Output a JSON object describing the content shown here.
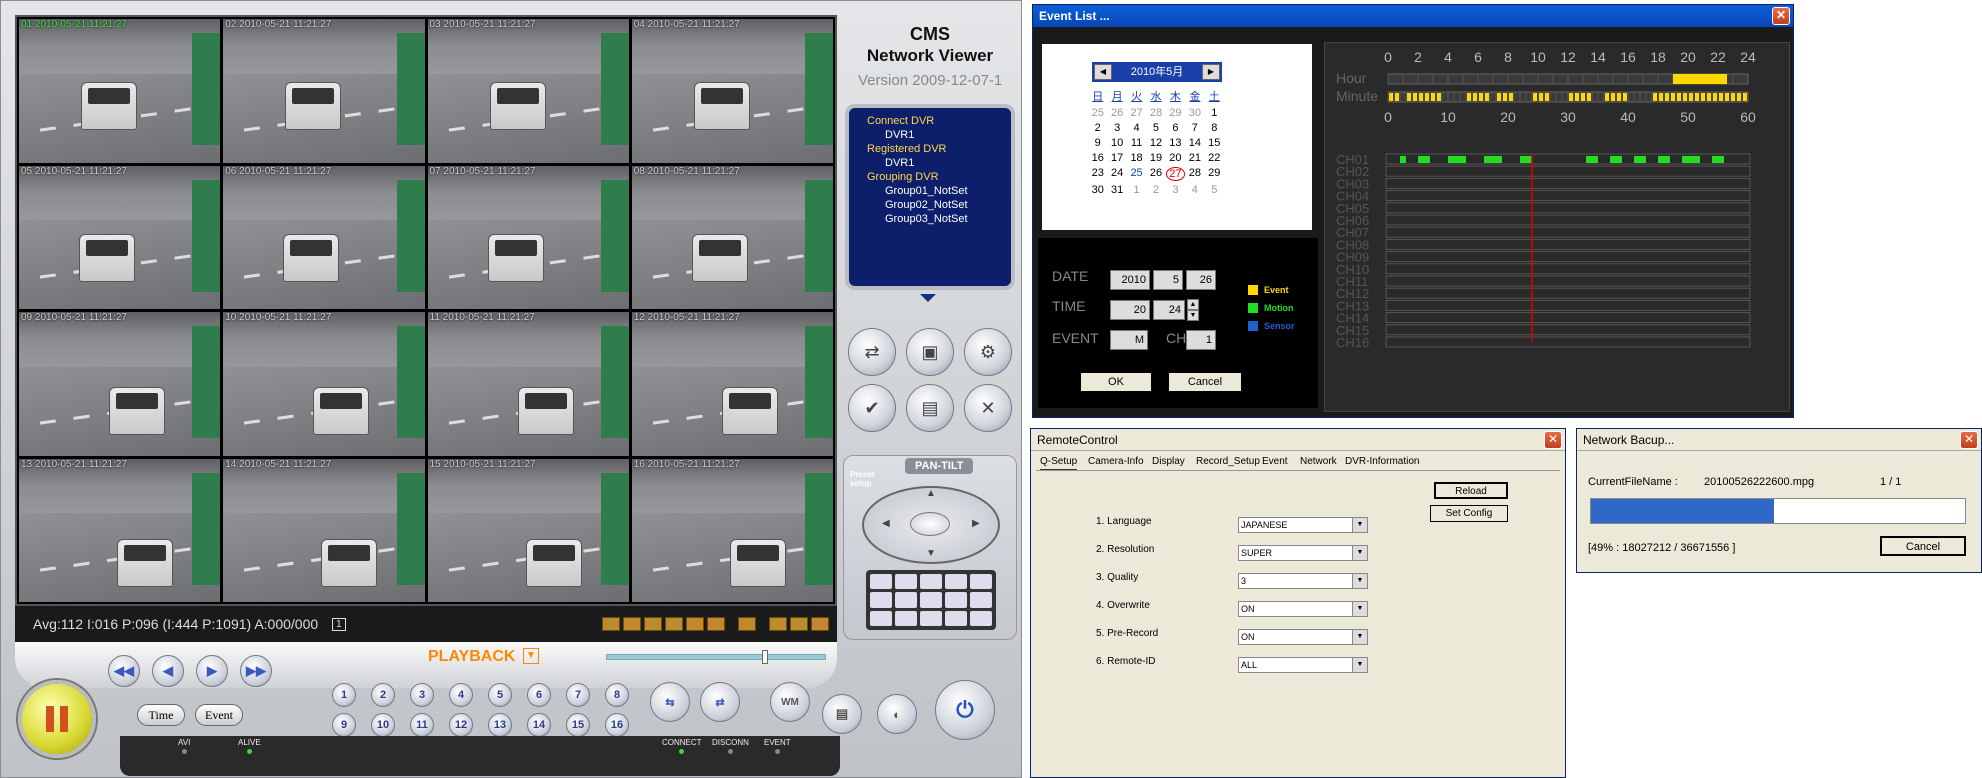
{
  "cms": {
    "brand_line1": "CMS",
    "brand_line2": "Network Viewer",
    "version": "Version 2009-12-07-1",
    "tiles": [
      "01 2010-05-21 11:21:27",
      "02 2010-05-21 11:21:27",
      "03 2010-05-21 11:21:27",
      "04 2010-05-21 11:21:27",
      "05 2010-05-21 11:21:27",
      "06 2010-05-21 11:21:27",
      "07 2010-05-21 11:21:27",
      "08 2010-05-21 11:21:27",
      "09 2010-05-21 11:21:27",
      "10 2010-05-21 11:21:27",
      "11 2010-05-21 11:21:27",
      "12 2010-05-21 11:21:27",
      "13 2010-05-21 11:21:27",
      "14 2010-05-21 11:21:27",
      "15 2010-05-21 11:21:27",
      "16 2010-05-21 11:21:27"
    ],
    "status_text": "Avg:112 I:016 P:096 (I:444 P:1091) A:000/000",
    "status_channel": "1",
    "playback_label": "PLAYBACK",
    "time_button": "Time",
    "event_button": "Event",
    "channel_numbers": [
      "1",
      "2",
      "3",
      "4",
      "5",
      "6",
      "7",
      "8",
      "9",
      "10",
      "11",
      "12",
      "13",
      "14",
      "15",
      "16"
    ],
    "indicators": {
      "avi": "AVI",
      "alive": "ALIVE",
      "connect": "CONNECT",
      "disconn": "DISCONN",
      "event": "EVENT"
    },
    "tree": {
      "connect_dvr": "Connect DVR",
      "connect_dvr1": "DVR1",
      "registered_dvr": "Registered DVR",
      "registered_dvr1": "DVR1",
      "grouping_dvr": "Grouping DVR",
      "group1": "Group01_NotSet",
      "group2": "Group02_NotSet",
      "group3": "Group03_NotSet"
    },
    "pantilt_label": "PAN-TILT",
    "preset_label_1": "Preset",
    "preset_label_2": "setup",
    "colors": {
      "timestamp_first": "#40e040",
      "playback": "#ff8800",
      "tree_bg": "#0d1f6a",
      "tree_header": "#ffd84a"
    }
  },
  "event_list": {
    "title": "Event List ...",
    "calendar_month": "2010年5月",
    "weekdays": [
      "日",
      "月",
      "火",
      "水",
      "木",
      "金",
      "土"
    ],
    "days": [
      [
        "25",
        "26",
        "27",
        "28",
        "29",
        "30",
        "1"
      ],
      [
        "2",
        "3",
        "4",
        "5",
        "6",
        "7",
        "8"
      ],
      [
        "9",
        "10",
        "11",
        "12",
        "13",
        "14",
        "15"
      ],
      [
        "16",
        "17",
        "18",
        "19",
        "20",
        "21",
        "22"
      ],
      [
        "23",
        "24",
        "25",
        "26",
        "27",
        "28",
        "29"
      ],
      [
        "30",
        "31",
        "1",
        "2",
        "3",
        "4",
        "5"
      ]
    ],
    "selected_day": "27",
    "date_label": "DATE",
    "time_label": "TIME",
    "event_label": "EVENT",
    "ch_label": "CH",
    "date_year": "2010",
    "date_month": "5",
    "date_day": "26",
    "time_hour": "20",
    "time_min": "24",
    "event_value": "M",
    "ch_value": "1",
    "ok": "OK",
    "cancel": "Cancel",
    "legend": [
      {
        "label": "Event",
        "color": "#ffd800"
      },
      {
        "label": "Motion",
        "color": "#22dd22"
      },
      {
        "label": "Sensor",
        "color": "#2060d0"
      }
    ],
    "hour_label": "Hour",
    "minute_label": "Minute",
    "hour_ticks": [
      "0",
      "2",
      "4",
      "6",
      "8",
      "10",
      "12",
      "14",
      "16",
      "18",
      "20",
      "22",
      "24"
    ],
    "minute_ticks": [
      "0",
      "10",
      "20",
      "30",
      "40",
      "50",
      "60"
    ],
    "channels": [
      "CH01",
      "CH02",
      "CH03",
      "CH04",
      "CH05",
      "CH06",
      "CH07",
      "CH08",
      "CH09",
      "CH10",
      "CH11",
      "CH12",
      "CH13",
      "CH14",
      "CH15",
      "CH16"
    ]
  },
  "remote": {
    "title": "RemoteControl",
    "tabs": [
      "Q-Setup",
      "Camera-Info",
      "Display",
      "Record_Setup",
      "Event",
      "Network",
      "DVR-Information"
    ],
    "reload": "Reload",
    "set_config": "Set Config",
    "fields": [
      {
        "label": "1. Language",
        "value": "JAPANESE"
      },
      {
        "label": "2. Resolution",
        "value": "SUPER"
      },
      {
        "label": "3. Quality",
        "value": "3"
      },
      {
        "label": "4. Overwrite",
        "value": "ON"
      },
      {
        "label": "5. Pre-Record",
        "value": "ON"
      },
      {
        "label": "6. Remote-ID",
        "value": "ALL"
      }
    ]
  },
  "backup": {
    "title": "Network Bacup...",
    "file_label": "CurrentFileName :",
    "file_name": "20100526222600.mpg",
    "count": "1 / 1",
    "progress_fraction": 0.49,
    "progress_text": "[49% : 18027212 / 36671556 ]",
    "cancel": "Cancel"
  }
}
